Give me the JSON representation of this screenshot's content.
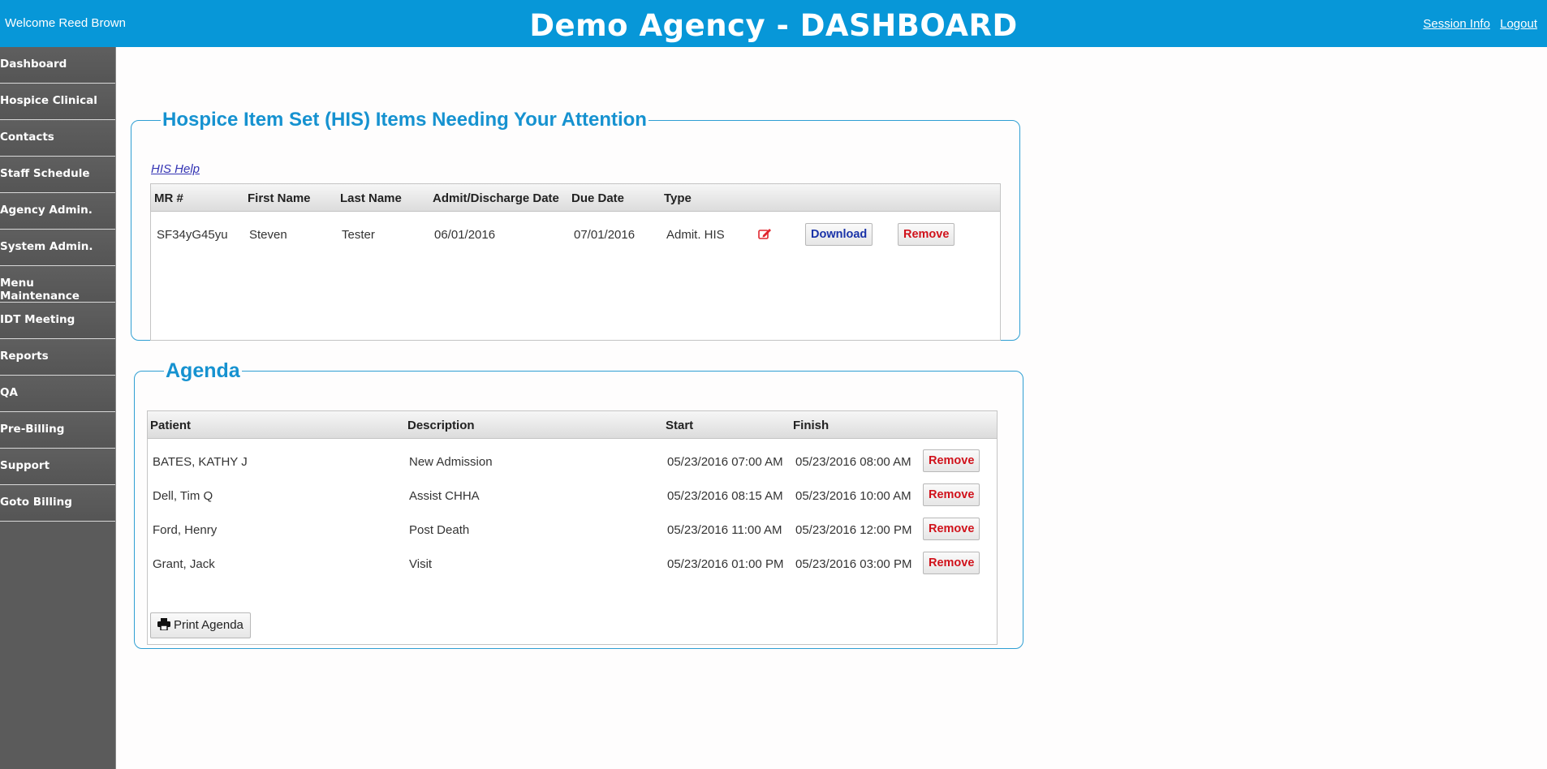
{
  "header": {
    "welcome": "Welcome Reed Brown",
    "title": "Demo Agency - DASHBOARD",
    "session_info": "Session Info",
    "logout": "Logout",
    "color": "#0797d8"
  },
  "sidebar": {
    "items": [
      {
        "label": "Dashboard"
      },
      {
        "label": "Hospice Clinical"
      },
      {
        "label": "Contacts"
      },
      {
        "label": "Staff Schedule"
      },
      {
        "label": "Agency Admin."
      },
      {
        "label": "System Admin."
      },
      {
        "label": "Menu Maintenance"
      },
      {
        "label": "IDT Meeting"
      },
      {
        "label": "Reports"
      },
      {
        "label": "QA"
      },
      {
        "label": "Pre-Billing"
      },
      {
        "label": "Support"
      },
      {
        "label": "Goto Billing"
      }
    ]
  },
  "his": {
    "legend": "Hospice Item Set (HIS) Items Needing Your Attention",
    "help": "HIS Help",
    "columns": {
      "mr": "MR #",
      "first": "First Name",
      "last": "Last Name",
      "admit": "Admit/Discharge Date",
      "due": "Due Date",
      "type": "Type"
    },
    "rows": [
      {
        "mr": "SF34yG45yu",
        "first": "Steven",
        "last": "Tester",
        "admit": "06/01/2016",
        "due": "07/01/2016",
        "type": "Admit. HIS",
        "edit_icon": "edit-icon",
        "download": "Download",
        "remove": "Remove"
      }
    ]
  },
  "agenda": {
    "legend": "Agenda",
    "columns": {
      "patient": "Patient",
      "description": "Description",
      "start": "Start",
      "finish": "Finish"
    },
    "rows": [
      {
        "patient": "BATES, KATHY J",
        "description": "New Admission",
        "start": "05/23/2016 07:00 AM",
        "finish": "05/23/2016 08:00 AM",
        "remove": "Remove"
      },
      {
        "patient": "Dell, Tim Q",
        "description": "Assist CHHA",
        "start": "05/23/2016 08:15 AM",
        "finish": "05/23/2016 10:00 AM",
        "remove": "Remove"
      },
      {
        "patient": "Ford, Henry",
        "description": "Post Death",
        "start": "05/23/2016 11:00 AM",
        "finish": "05/23/2016 12:00 PM",
        "remove": "Remove"
      },
      {
        "patient": "Grant, Jack",
        "description": "Visit",
        "start": "05/23/2016 01:00 PM",
        "finish": "05/23/2016 03:00 PM",
        "remove": "Remove"
      }
    ],
    "print_label": "Print Agenda",
    "print_icon": "printer-icon"
  }
}
